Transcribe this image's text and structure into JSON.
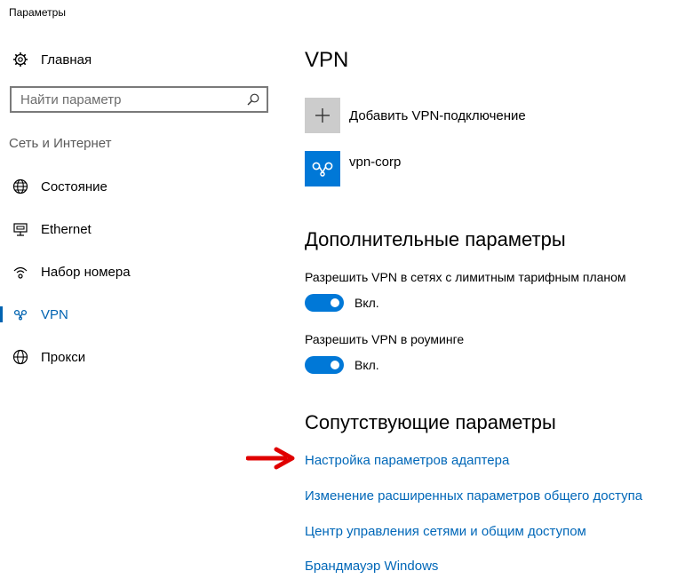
{
  "window": {
    "title": "Параметры"
  },
  "sidebar": {
    "home_label": "Главная",
    "search_placeholder": "Найти параметр",
    "group_title": "Сеть и Интернет",
    "items": [
      {
        "label": "Состояние",
        "icon": "globe-status-icon"
      },
      {
        "label": "Ethernet",
        "icon": "ethernet-icon"
      },
      {
        "label": "Набор номера",
        "icon": "dialup-icon"
      },
      {
        "label": "VPN",
        "icon": "vpn-icon",
        "active": true
      },
      {
        "label": "Прокси",
        "icon": "globe-icon"
      }
    ]
  },
  "main": {
    "title": "VPN",
    "add_vpn_label": "Добавить VPN-подключение",
    "connections": [
      {
        "name": "vpn-corp"
      }
    ],
    "advanced": {
      "title": "Дополнительные параметры",
      "options": [
        {
          "label": "Разрешить VPN в сетях с лимитным тарифным планом",
          "state": "Вкл.",
          "on": true
        },
        {
          "label": "Разрешить VPN в роуминге",
          "state": "Вкл.",
          "on": true
        }
      ]
    },
    "related": {
      "title": "Сопутствующие параметры",
      "links": [
        "Настройка параметров адаптера",
        "Изменение расширенных параметров общего доступа",
        "Центр управления сетями и общим доступом",
        "Брандмауэр Windows"
      ]
    }
  },
  "colors": {
    "accent": "#0078d7",
    "link": "#0067b8",
    "annotation_arrow": "#e00000"
  }
}
